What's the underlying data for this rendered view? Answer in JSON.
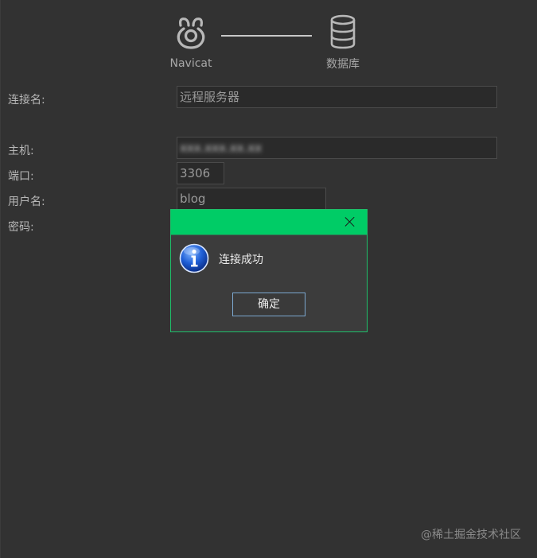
{
  "header": {
    "source_label": "Navicat",
    "target_label": "数据库"
  },
  "form": {
    "connection_name_label": "连接名:",
    "connection_name_value": "远程服务器",
    "host_label": "主机:",
    "host_value": "xxx.xxx.xx.xx",
    "port_label": "端口:",
    "port_value": "3306",
    "username_label": "用户名:",
    "username_value": "blog",
    "password_label": "密码:"
  },
  "dialog": {
    "message": "连接成功",
    "ok_label": "确定",
    "accent_color": "#00cc66"
  },
  "watermark": "@稀土掘金技术社区"
}
